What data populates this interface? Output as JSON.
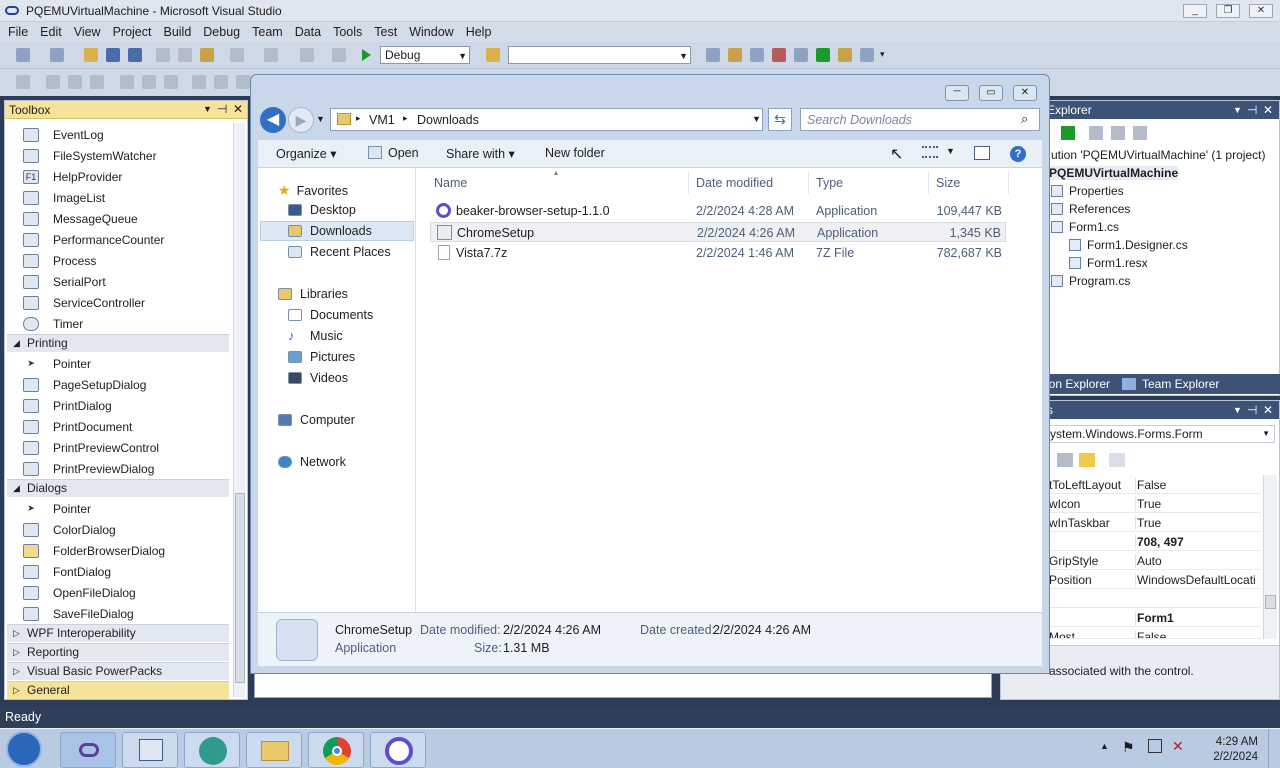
{
  "vs": {
    "title": "PQEMUVirtualMachine - Microsoft Visual Studio",
    "menu": [
      "File",
      "Edit",
      "View",
      "Project",
      "Build",
      "Debug",
      "Team",
      "Data",
      "Tools",
      "Test",
      "Window",
      "Help"
    ],
    "config_combo": "Debug",
    "platform_combo": "",
    "status": "Ready"
  },
  "toolbox": {
    "title": "Toolbox",
    "components": [
      "EventLog",
      "FileSystemWatcher",
      "HelpProvider",
      "ImageList",
      "MessageQueue",
      "PerformanceCounter",
      "Process",
      "SerialPort",
      "ServiceController",
      "Timer"
    ],
    "printing_label": "Printing",
    "printing": [
      "Pointer",
      "PageSetupDialog",
      "PrintDialog",
      "PrintDocument",
      "PrintPreviewControl",
      "PrintPreviewDialog"
    ],
    "dialogs_label": "Dialogs",
    "dialogs": [
      "Pointer",
      "ColorDialog",
      "FolderBrowserDialog",
      "FontDialog",
      "OpenFileDialog",
      "SaveFileDialog"
    ],
    "collapsed": [
      "WPF Interoperability",
      "Reporting",
      "Visual Basic PowerPacks",
      "General"
    ]
  },
  "solution_explorer": {
    "title": "Explorer",
    "solution": "ution 'PQEMUVirtualMachine' (1 project)",
    "project": "PQEMUVirtualMachine",
    "items": [
      "Properties",
      "References",
      "Form1.cs",
      "Form1.Designer.cs",
      "Form1.resx",
      "Program.cs"
    ],
    "tab1": "ion Explorer",
    "tab2": "Team Explorer"
  },
  "properties": {
    "title": "s",
    "object": "ystem.Windows.Forms.Form",
    "rows": [
      {
        "k": "tToLeftLayout",
        "v": "False"
      },
      {
        "k": "wIcon",
        "v": "True"
      },
      {
        "k": "wInTaskbar",
        "v": "True"
      },
      {
        "k": "",
        "v": "708, 497"
      },
      {
        "k": "GripStyle",
        "v": "Auto"
      },
      {
        "k": "Position",
        "v": "WindowsDefaultLocati"
      },
      {
        "k": "",
        "v": ""
      },
      {
        "k": "",
        "v": "Form1"
      },
      {
        "k": "Most",
        "v": "False"
      }
    ],
    "description": "associated with the control."
  },
  "explorer": {
    "path": [
      "VM1",
      "Downloads"
    ],
    "search_placeholder": "Search Downloads",
    "commands": {
      "organize": "Organize",
      "open": "Open",
      "share": "Share with",
      "new_folder": "New folder"
    },
    "nav": {
      "favorites": "Favorites",
      "fav_items": [
        "Desktop",
        "Downloads",
        "Recent Places"
      ],
      "libraries": "Libraries",
      "lib_items": [
        "Documents",
        "Music",
        "Pictures",
        "Videos"
      ],
      "computer": "Computer",
      "network": "Network"
    },
    "columns": {
      "name": "Name",
      "date": "Date modified",
      "type": "Type",
      "size": "Size"
    },
    "files": [
      {
        "name": "beaker-browser-setup-1.1.0",
        "date": "2/2/2024 4:28 AM",
        "type": "Application",
        "size": "109,447 KB"
      },
      {
        "name": "ChromeSetup",
        "date": "2/2/2024 4:26 AM",
        "type": "Application",
        "size": "1,345 KB"
      },
      {
        "name": "Vista7.7z",
        "date": "2/2/2024 1:46 AM",
        "type": "7Z File",
        "size": "782,687 KB"
      }
    ],
    "details": {
      "name": "ChromeSetup",
      "kind": "Application",
      "modified_label": "Date modified:",
      "modified": "2/2/2024 4:26 AM",
      "created_label": "Date created:",
      "created": "2/2/2024 4:26 AM",
      "size_label": "Size:",
      "size": "1.31 MB"
    }
  },
  "taskbar": {
    "time": "4:29 AM",
    "date": "2/2/2024"
  }
}
